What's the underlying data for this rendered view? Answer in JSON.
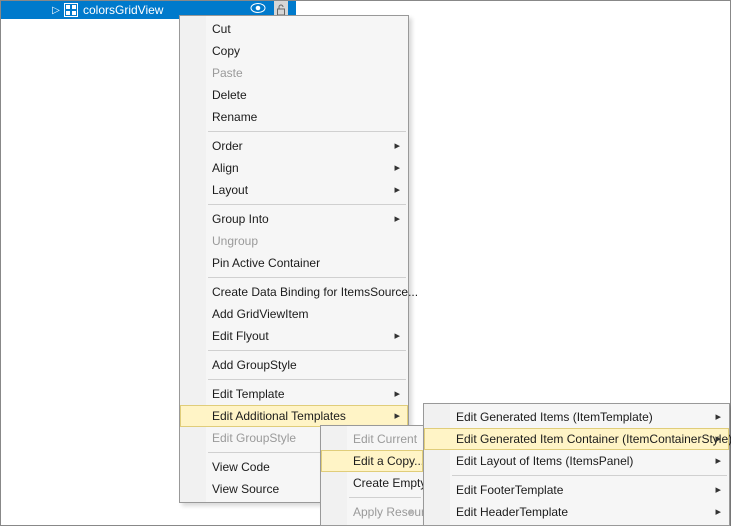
{
  "tree": {
    "item_name": "colorsGridView",
    "visibility_icon": "eye-icon",
    "lock_icon": "lock-icon"
  },
  "menu1": {
    "cut": "Cut",
    "copy": "Copy",
    "paste": "Paste",
    "delete": "Delete",
    "rename": "Rename",
    "order": "Order",
    "align": "Align",
    "layout": "Layout",
    "group_into": "Group Into",
    "ungroup": "Ungroup",
    "pin_active": "Pin Active Container",
    "create_binding": "Create Data Binding for ItemsSource...",
    "add_gridviewitem": "Add GridViewItem",
    "edit_flyout": "Edit Flyout",
    "add_groupstyle": "Add GroupStyle",
    "edit_template": "Edit Template",
    "edit_additional": "Edit Additional Templates",
    "edit_groupstyle": "Edit GroupStyle",
    "view_code": "View Code",
    "view_source": "View Source"
  },
  "menu2": {
    "edit_current": "Edit Current",
    "edit_copy": "Edit a Copy...",
    "create_empty": "Create Empty...",
    "apply_resource": "Apply Resource"
  },
  "menu3": {
    "gen_items": "Edit Generated Items (ItemTemplate)",
    "gen_container": "Edit Generated Item Container (ItemContainerStyle)",
    "layout_items": "Edit Layout of Items (ItemsPanel)",
    "footer": "Edit FooterTemplate",
    "header": "Edit HeaderTemplate"
  }
}
